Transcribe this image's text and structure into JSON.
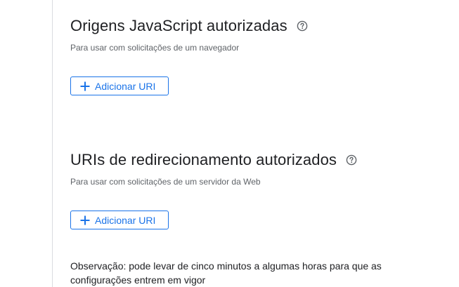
{
  "sections": {
    "js_origins": {
      "title": "Origens JavaScript autorizadas",
      "description": "Para usar com solicitações de um navegador",
      "add_button_label": "Adicionar URI"
    },
    "redirect_uris": {
      "title": "URIs de redirecionamento autorizados",
      "description": "Para usar com solicitações de um servidor da Web",
      "add_button_label": "Adicionar URI"
    }
  },
  "note": "Observação: pode levar de cinco minutos a algumas horas para que as configurações entrem em vigor",
  "icons": {
    "help": "help-circle-icon",
    "add": "plus-icon"
  },
  "colors": {
    "accent": "#1a73e8",
    "text": "#202124",
    "secondary_text": "#5f6368",
    "divider": "#dadce0"
  }
}
